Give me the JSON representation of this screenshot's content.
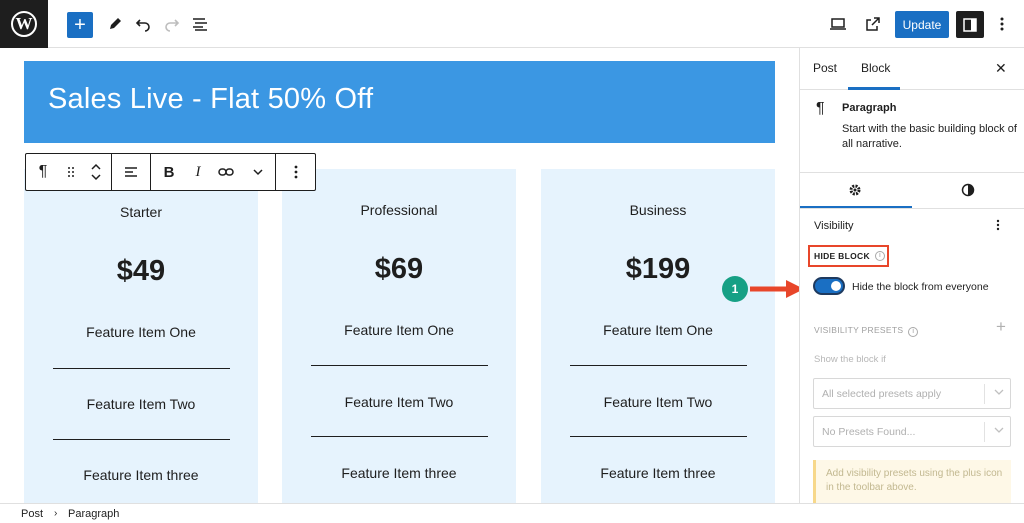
{
  "toolbar": {
    "logo": "W",
    "add_label": "+",
    "update_label": "Update"
  },
  "canvas": {
    "banner_title": "Sales Live - Flat 50% Off",
    "block_toolbar": {
      "paragraph_glyph": "¶",
      "bold": "B",
      "italic": "I"
    },
    "cards": [
      {
        "plan": "Starter",
        "price": "$49",
        "features": [
          "Feature Item One",
          "Feature Item Two",
          "Feature Item three"
        ]
      },
      {
        "plan": "Professional",
        "price": "$69",
        "features": [
          "Feature Item One",
          "Feature Item Two",
          "Feature Item three"
        ]
      },
      {
        "plan": "Business",
        "price": "$199",
        "features": [
          "Feature Item One",
          "Feature Item Two",
          "Feature Item three"
        ]
      }
    ]
  },
  "sidebar": {
    "tabs": [
      "Post",
      "Block"
    ],
    "active_tab": "Block",
    "close": "✕",
    "block_title": "Paragraph",
    "block_desc": "Start with the basic building block of all narrative.",
    "visibility": {
      "title": "Visibility",
      "hide_block_label": "HIDE BLOCK",
      "toggle_on": true,
      "toggle_label": "Hide the block from everyone",
      "presets_title": "VISIBILITY PRESETS",
      "show_if": "Show the block if",
      "select_apply": "All selected presets apply",
      "select_presets": "No Presets Found...",
      "notice": "Add visibility presets using the plus icon in the toolbar above."
    }
  },
  "annotation": {
    "step": "1",
    "arrow_color": "#e8462a",
    "badge_color": "#16a085"
  },
  "breadcrumb": [
    "Post",
    "Paragraph"
  ],
  "colors": {
    "accent": "#1a6fc3",
    "banner": "#3b97e3",
    "card_bg": "#e6f3fd",
    "highlight_box": "#e8462a"
  }
}
